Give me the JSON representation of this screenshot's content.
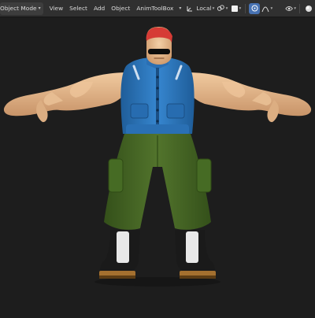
{
  "header": {
    "mode_label": "Object Mode",
    "menus": [
      "View",
      "Select",
      "Add",
      "Object",
      "AnimToolBox"
    ],
    "transform_orientation": "Local",
    "icons": [
      "transform-orientation-icon",
      "pivot-icon",
      "snap-magnet-icon",
      "snap-target-icon",
      "proportional-editing-icon",
      "falloff-curve-icon",
      "visibility-icon",
      "viewport-shading-icon"
    ]
  },
  "viewport": {
    "background": "#1d1d1d",
    "subject": "character-model"
  },
  "colors": {
    "header_bg": "#303030",
    "active_blue": "#4772b3",
    "vest": "#2f78bd",
    "pants": "#4a6a26",
    "hair": "#e0453e",
    "skin": "#e6b98e"
  }
}
